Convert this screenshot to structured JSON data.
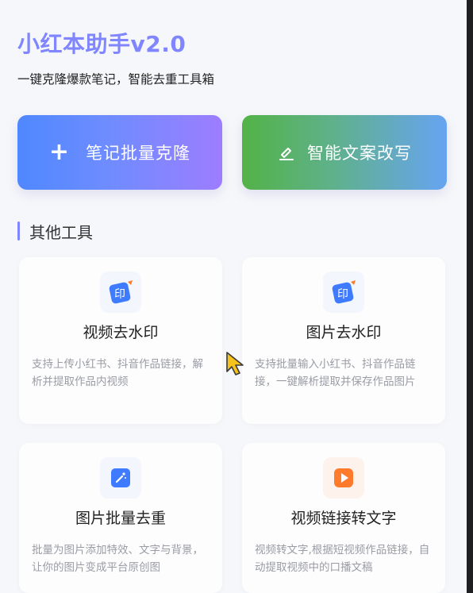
{
  "app": {
    "title": "小红本助手v2.0",
    "subtitle": "一键克隆爆款笔记，智能去重工具箱"
  },
  "hero_buttons": [
    {
      "label": "笔记批量克隆",
      "icon": "plus-icon"
    },
    {
      "label": "智能文案改写",
      "icon": "pencil-icon"
    }
  ],
  "section": {
    "title": "其他工具"
  },
  "tools": [
    {
      "title": "视频去水印",
      "desc": "支持上传小红书、抖音作品链接，解析并提取作品内视频",
      "icon": "watermark-seal-icon",
      "icon_glyph": "印"
    },
    {
      "title": "图片去水印",
      "desc": "支持批量输入小红书、抖音作品链接，一键解析提取并保存作品图片",
      "icon": "watermark-seal-icon",
      "icon_glyph": "印"
    },
    {
      "title": "图片批量去重",
      "desc": "批量为图片添加特效、文字与背景，让你的图片变成平台原创图",
      "icon": "magic-wand-icon"
    },
    {
      "title": "视频链接转文字",
      "desc": "视频转文字,根据短视频作品链接，自动提取视频中的口播文稿",
      "icon": "play-icon"
    }
  ],
  "colors": {
    "accent": "#7f86ff",
    "clone_gradient": [
      "#4f88ff",
      "#9d7dff"
    ],
    "rewrite_gradient": [
      "#53b247",
      "#67a4f2"
    ],
    "blue_icon": "#3f7bff",
    "orange_icon": "#ff7a2b"
  }
}
